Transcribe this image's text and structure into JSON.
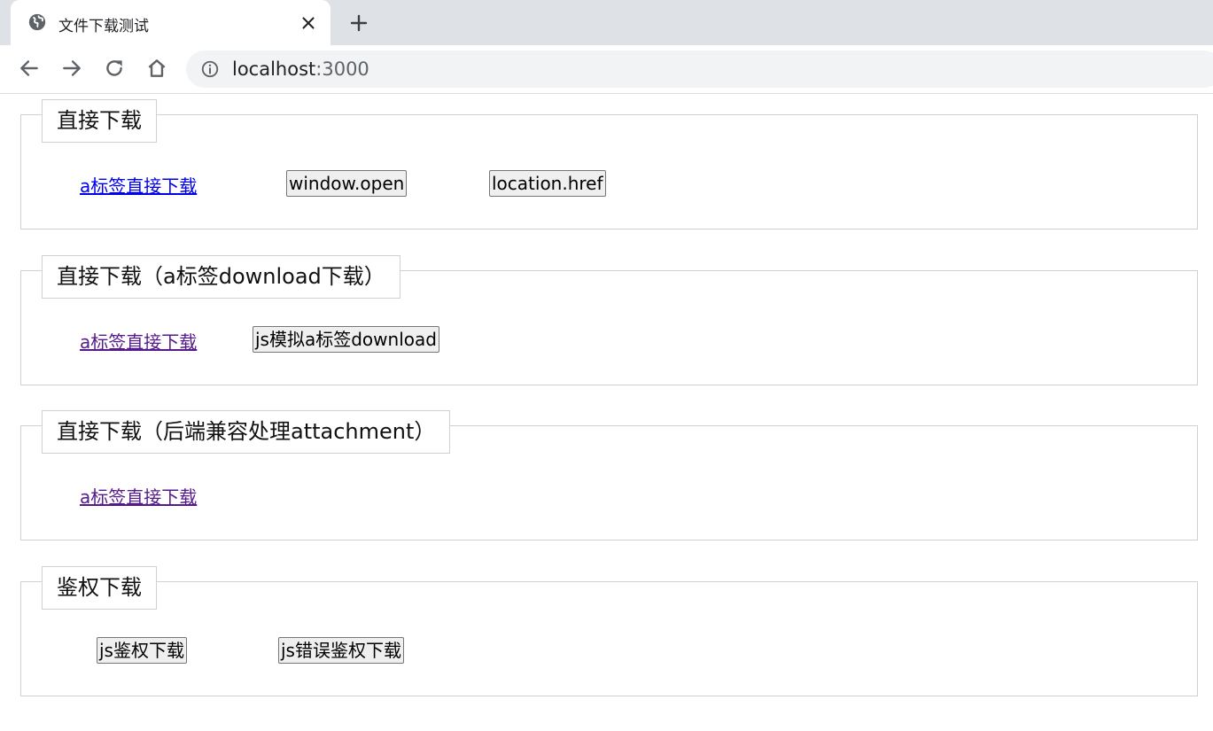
{
  "browser": {
    "tab": {
      "title": "文件下载测试",
      "favicon": "globe-icon",
      "close_icon": "close-icon"
    },
    "new_tab_icon": "plus-icon",
    "nav": {
      "back": "arrow-left-icon",
      "forward": "arrow-right-icon",
      "reload": "reload-icon",
      "home": "home-icon"
    },
    "address": {
      "host": "localhost",
      "port": ":3000",
      "icon": "info-icon"
    }
  },
  "sections": [
    {
      "legend": "直接下载",
      "link": "a标签直接下载",
      "link_state": "unvisited",
      "buttons": [
        "window.open",
        "location.href"
      ]
    },
    {
      "legend": "直接下载（a标签download下载）",
      "link": "a标签直接下载",
      "link_state": "visited",
      "buttons": [
        "js模拟a标签download"
      ]
    },
    {
      "legend": "直接下载（后端兼容处理attachment）",
      "link": "a标签直接下载",
      "link_state": "visited",
      "buttons": []
    },
    {
      "legend": "鉴权下载",
      "buttons": [
        "js鉴权下载",
        "js错误鉴权下载"
      ]
    }
  ],
  "colors": {
    "link": "#0000ee",
    "visited_link": "#551a8b",
    "chrome_bg": "#dee1e6",
    "omnibox_bg": "#f1f3f4"
  }
}
